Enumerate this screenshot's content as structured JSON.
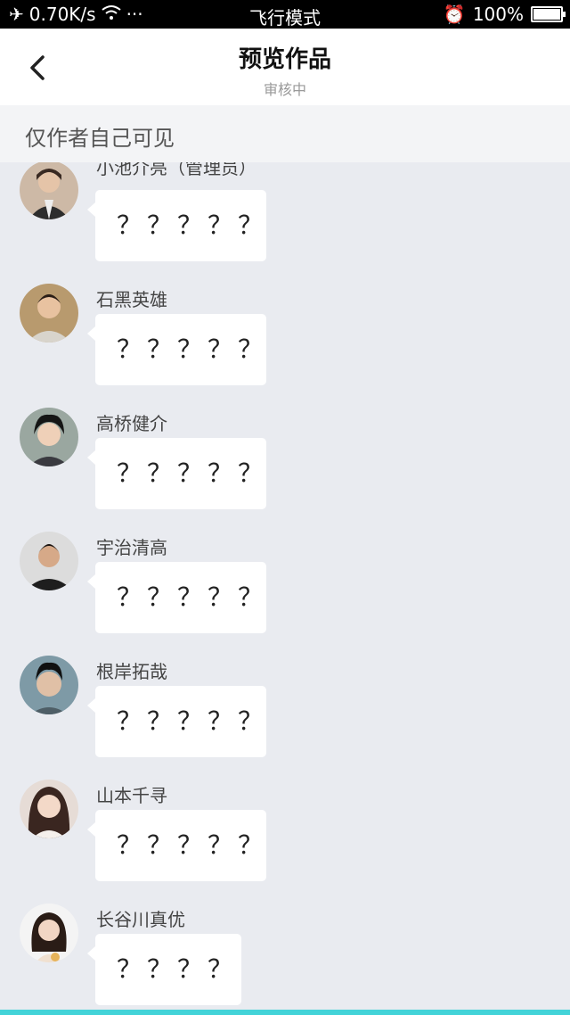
{
  "status_bar": {
    "speed": "0.70K/s",
    "dots": "···",
    "mode": "飞行模式",
    "battery": "100%"
  },
  "header": {
    "title": "预览作品",
    "subtitle": "审核中"
  },
  "notice": "仅作者自己可见",
  "messages": [
    {
      "name": "小池介亮（管理员）",
      "text": "？？？？？"
    },
    {
      "name": "石黑英雄",
      "text": "？？？？？"
    },
    {
      "name": "高桥健介",
      "text": "？？？？？"
    },
    {
      "name": "宇治清高",
      "text": "？？？？？"
    },
    {
      "name": "根岸拓哉",
      "text": "？？？？？"
    },
    {
      "name": "山本千寻",
      "text": "？？？？？"
    },
    {
      "name": "长谷川真优",
      "text": "？？？？"
    }
  ],
  "colors": {
    "background": "#e9ebf0",
    "accent_bottom": "#43d3d8"
  }
}
